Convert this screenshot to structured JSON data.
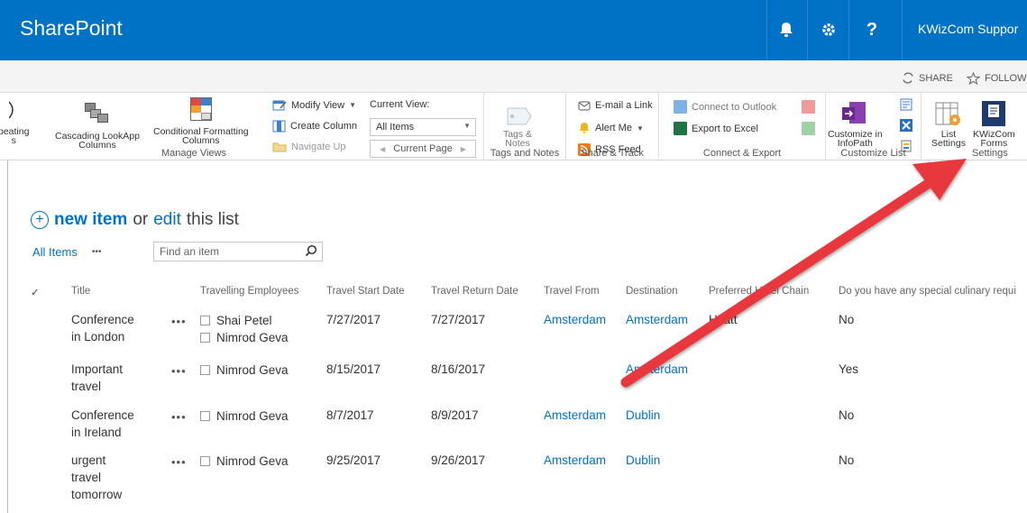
{
  "suitebar": {
    "brand": "SharePoint",
    "user": "KWizCom Suppor",
    "help": "?"
  },
  "tabbar": {
    "share": "SHARE",
    "follow": "FOLLOW"
  },
  "ribbon": {
    "manage_views": {
      "label": "Manage Views",
      "repeating": "peating",
      "repeating_2": "s",
      "cascading_line1": "Cascading LookApp",
      "cascading_line2": "Columns",
      "conditional_line1": "Conditional Formatting",
      "conditional_line2": "Columns",
      "modify_view": "Modify View",
      "create_column": "Create Column",
      "navigate_up": "Navigate Up",
      "current_view_label": "Current View:",
      "current_view_value": "All Items",
      "current_page": "Current Page"
    },
    "tags_notes": {
      "label": "Tags and Notes",
      "button_line1": "Tags &",
      "button_line2": "Notes"
    },
    "share_track": {
      "label": "Share & Track",
      "email": "E-mail a Link",
      "alert": "Alert Me",
      "rss": "RSS Feed"
    },
    "connect_export": {
      "label": "Connect & Export",
      "outlook": "Connect to Outlook",
      "excel": "Export to Excel"
    },
    "customize_list": {
      "label": "Customize List",
      "infopath_line1": "Customize in",
      "infopath_line2": "InfoPath"
    },
    "settings": {
      "label": "Settings",
      "list_settings_line1": "List",
      "list_settings_line2": "Settings",
      "kwizcom_line1": "KWizCom",
      "kwizcom_line2": "Forms"
    }
  },
  "list": {
    "new_item": "new item",
    "or": "or",
    "edit": "edit",
    "this_list": "this list",
    "view_name": "All Items",
    "view_more": "•••",
    "search_placeholder": "Find an item",
    "columns": [
      "Title",
      "Travelling Employees",
      "Travel Start Date",
      "Travel Return Date",
      "Travel From",
      "Destination",
      "Preferred Hotel Chain",
      "Do you have any special culinary requi"
    ],
    "rows": [
      {
        "title_1": "Conference",
        "title_2": "in London",
        "title_3": "",
        "employee_1": "Shai Petel",
        "employee_2": "Nimrod Geva",
        "start": "7/27/2017",
        "return": "7/27/2017",
        "from": "Amsterdam",
        "destination": "Amsterdam",
        "hotel": "Hyatt",
        "culinary": "No"
      },
      {
        "title_1": "Important",
        "title_2": "travel",
        "title_3": "",
        "employee_1": "Nimrod Geva",
        "employee_2": "",
        "start": "8/15/2017",
        "return": "8/16/2017",
        "from": "",
        "destination": "Amsterdam",
        "hotel": "",
        "culinary": "Yes"
      },
      {
        "title_1": "Conference",
        "title_2": "in Ireland",
        "title_3": "",
        "employee_1": "Nimrod Geva",
        "employee_2": "",
        "start": "8/7/2017",
        "return": "8/9/2017",
        "from": "Amsterdam",
        "destination": "Dublin",
        "hotel": "",
        "culinary": "No"
      },
      {
        "title_1": "urgent",
        "title_2": "travel",
        "title_3": "tomorrow",
        "employee_1": "Nimrod Geva",
        "employee_2": "",
        "start": "9/25/2017",
        "return": "9/26/2017",
        "from": "Amsterdam",
        "destination": "Dublin",
        "hotel": "",
        "culinary": "No"
      }
    ]
  },
  "colors": {
    "suitebar": "#0072c6",
    "link": "#0072c6",
    "arrow": "#e8383d"
  }
}
